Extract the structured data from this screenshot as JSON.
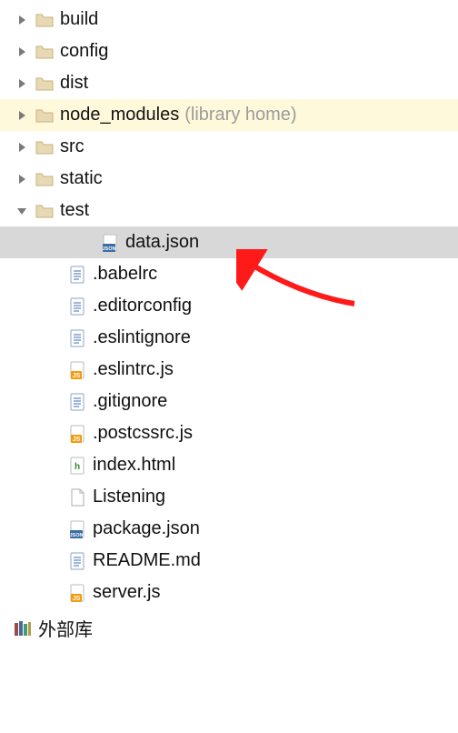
{
  "tree": {
    "items": [
      {
        "label": "build",
        "icon": "folder",
        "arrow": "right",
        "depth": 0,
        "state": "normal"
      },
      {
        "label": "config",
        "icon": "folder",
        "arrow": "right",
        "depth": 0,
        "state": "normal"
      },
      {
        "label": "dist",
        "icon": "folder",
        "arrow": "right",
        "depth": 0,
        "state": "normal"
      },
      {
        "label": "node_modules",
        "note": "(library home)",
        "icon": "folder",
        "arrow": "right",
        "depth": 0,
        "state": "highlight"
      },
      {
        "label": "src",
        "icon": "folder",
        "arrow": "right",
        "depth": 0,
        "state": "normal"
      },
      {
        "label": "static",
        "icon": "folder",
        "arrow": "right",
        "depth": 0,
        "state": "normal"
      },
      {
        "label": "test",
        "icon": "folder",
        "arrow": "down",
        "depth": 0,
        "state": "normal"
      },
      {
        "label": "data.json",
        "icon": "json",
        "arrow": "",
        "depth": 2,
        "state": "selected"
      },
      {
        "label": ".babelrc",
        "icon": "text",
        "arrow": "",
        "depth": 1,
        "state": "normal"
      },
      {
        "label": ".editorconfig",
        "icon": "text",
        "arrow": "",
        "depth": 1,
        "state": "normal"
      },
      {
        "label": ".eslintignore",
        "icon": "text",
        "arrow": "",
        "depth": 1,
        "state": "normal"
      },
      {
        "label": ".eslintrc.js",
        "icon": "js",
        "arrow": "",
        "depth": 1,
        "state": "normal"
      },
      {
        "label": ".gitignore",
        "icon": "text",
        "arrow": "",
        "depth": 1,
        "state": "normal"
      },
      {
        "label": ".postcssrc.js",
        "icon": "js",
        "arrow": "",
        "depth": 1,
        "state": "normal"
      },
      {
        "label": "index.html",
        "icon": "html",
        "arrow": "",
        "depth": 1,
        "state": "normal"
      },
      {
        "label": "Listening",
        "icon": "blank",
        "arrow": "",
        "depth": 1,
        "state": "normal"
      },
      {
        "label": "package.json",
        "icon": "json",
        "arrow": "",
        "depth": 1,
        "state": "normal"
      },
      {
        "label": "README.md",
        "icon": "text",
        "arrow": "",
        "depth": 1,
        "state": "normal"
      },
      {
        "label": "server.js",
        "icon": "js",
        "arrow": "",
        "depth": 1,
        "state": "normal"
      }
    ]
  },
  "footer": {
    "label": "外部库",
    "icon": "library"
  }
}
